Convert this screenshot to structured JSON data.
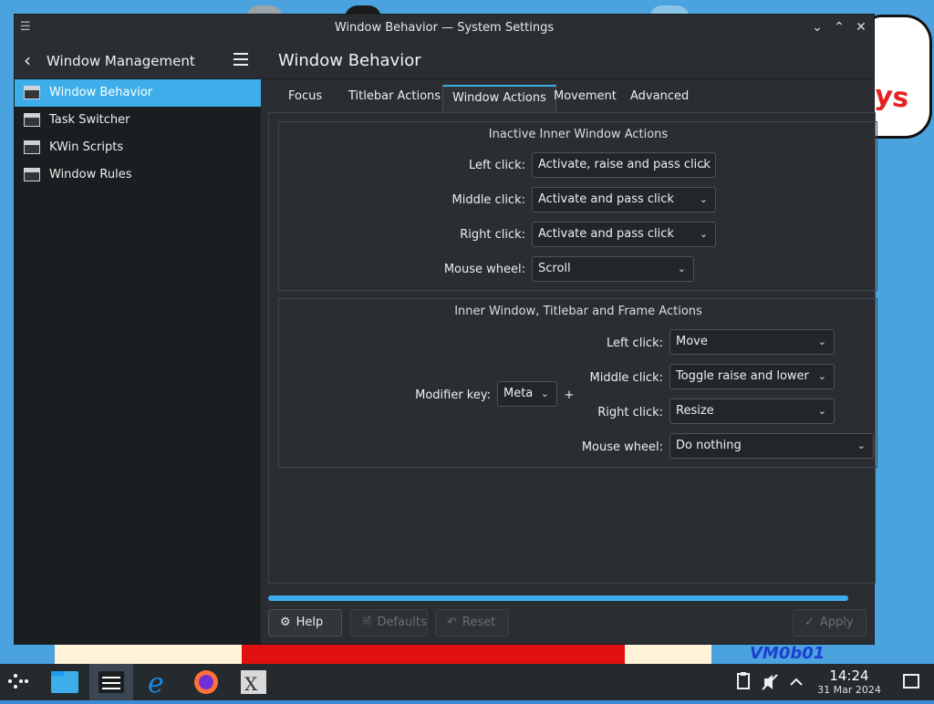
{
  "window": {
    "title": "Window Behavior — System Settings"
  },
  "sidebar": {
    "header": "Window Management",
    "items": [
      {
        "label": "Window Behavior",
        "icon": "window-icon",
        "active": true
      },
      {
        "label": "Task Switcher",
        "icon": "task-switcher-icon"
      },
      {
        "label": "KWin Scripts",
        "icon": "script-icon"
      },
      {
        "label": "Window Rules",
        "icon": "window-rules-icon"
      }
    ]
  },
  "main": {
    "title": "Window Behavior",
    "tabs": [
      "Focus",
      "Titlebar Actions",
      "Window Actions",
      "Movement",
      "Advanced"
    ],
    "active_tab": "Window Actions",
    "inactive": {
      "title": "Inactive Inner Window Actions",
      "rows": [
        {
          "label": "Left click:",
          "value": "Activate, raise and pass click"
        },
        {
          "label": "Middle click:",
          "value": "Activate and pass click"
        },
        {
          "label": "Right click:",
          "value": "Activate and pass click"
        },
        {
          "label": "Mouse wheel:",
          "value": "Scroll"
        }
      ]
    },
    "inner": {
      "title": "Inner Window, Titlebar and Frame Actions",
      "modifier_label": "Modifier key:",
      "modifier_value": "Meta",
      "plus": "+",
      "rows": [
        {
          "label": "Left click:",
          "value": "Move"
        },
        {
          "label": "Middle click:",
          "value": "Toggle raise and lower"
        },
        {
          "label": "Right click:",
          "value": "Resize"
        },
        {
          "label": "Mouse wheel:",
          "value": "Do nothing"
        }
      ]
    }
  },
  "buttons": {
    "help": "Help",
    "defaults": "Defaults",
    "reset": "Reset",
    "apply": "Apply"
  },
  "taskbar": {
    "time": "14:24",
    "date": "31 Mar 2024"
  },
  "wallpaper": {
    "text_fragment": "ys",
    "signature": "VM0b01"
  },
  "colors": {
    "accent": "#3daee9",
    "window_bg": "#2a2e32",
    "sidebar_bg": "#1b1e20"
  }
}
